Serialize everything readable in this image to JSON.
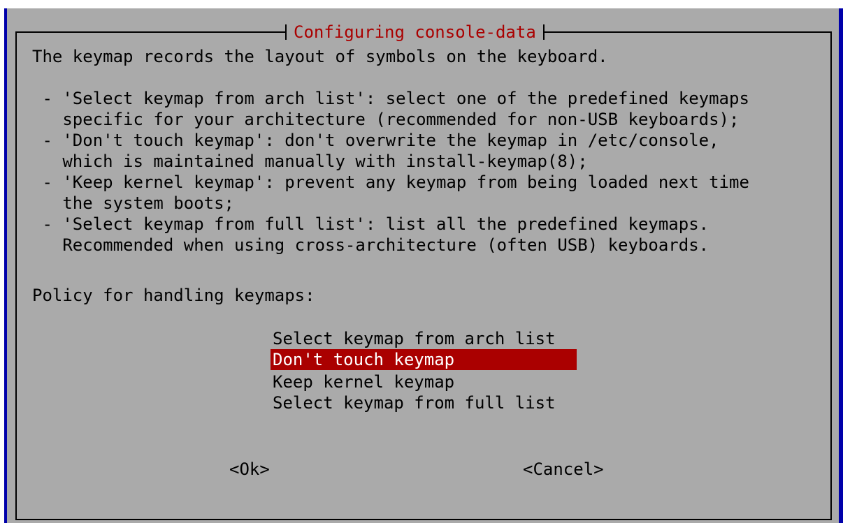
{
  "dialog": {
    "title": "Configuring console-data",
    "description_lines": [
      "The keymap records the layout of symbols on the keyboard.",
      "",
      " - 'Select keymap from arch list': select one of the predefined keymaps",
      "   specific for your architecture (recommended for non-USB keyboards);",
      " - 'Don't touch keymap': don't overwrite the keymap in /etc/console,",
      "   which is maintained manually with install-keymap(8);",
      " - 'Keep kernel keymap': prevent any keymap from being loaded next time",
      "   the system boots;",
      " - 'Select keymap from full list': list all the predefined keymaps.",
      "   Recommended when using cross-architecture (often USB) keyboards.",
      "",
      "Policy for handling keymaps:"
    ],
    "options": [
      "Select keymap from arch list",
      "Don't touch keymap",
      "Keep kernel keymap",
      "Select keymap from full list"
    ],
    "selected_option": "Don't touch keymap",
    "buttons": {
      "ok": "<Ok>",
      "cancel": "<Cancel>"
    }
  },
  "colors": {
    "background": "#0000aa",
    "dialog": "#aaaaaa",
    "title": "#aa0000",
    "selection": "#aa0000",
    "selection_text": "#ffffff"
  }
}
